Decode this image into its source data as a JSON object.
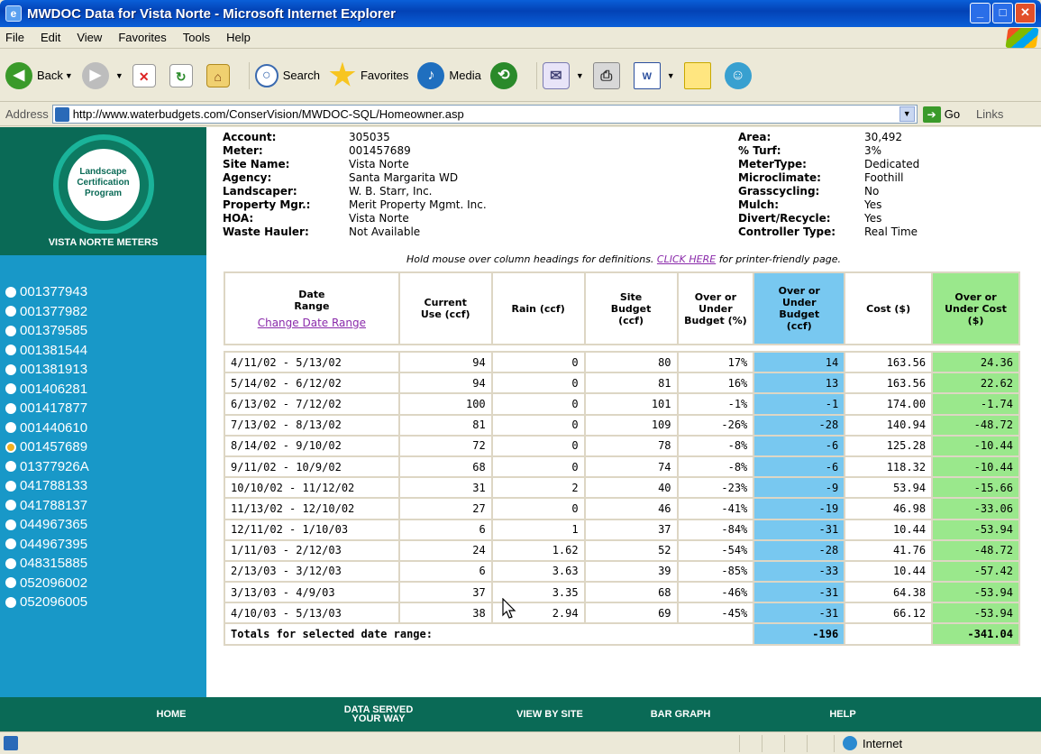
{
  "window": {
    "title": "MWDOC Data for Vista Norte - Microsoft Internet Explorer"
  },
  "menu": [
    "File",
    "Edit",
    "View",
    "Favorites",
    "Tools",
    "Help"
  ],
  "toolbar": {
    "back": "Back",
    "search": "Search",
    "favorites": "Favorites",
    "media": "Media"
  },
  "address": {
    "label": "Address",
    "url": "http://www.waterbudgets.com/ConserVision/MWDOC-SQL/Homeowner.asp",
    "go": "Go",
    "links": "Links"
  },
  "sidebar": {
    "logo_text": "Landscape Certification Program",
    "title": "VISTA NORTE METERS",
    "meters": [
      "001377943",
      "001377982",
      "001379585",
      "001381544",
      "001381913",
      "001406281",
      "001417877",
      "001440610",
      "001457689",
      "01377926A",
      "041788133",
      "041788137",
      "044967365",
      "044967395",
      "048315885",
      "052096002",
      "052096005"
    ],
    "selected_index": 8
  },
  "info_left": [
    {
      "k": "Account:",
      "v": "305035"
    },
    {
      "k": "Meter:",
      "v": "001457689"
    },
    {
      "k": "Site Name:",
      "v": "Vista Norte"
    },
    {
      "k": "Agency:",
      "v": "Santa Margarita WD"
    },
    {
      "k": "Landscaper:",
      "v": "W. B. Starr, Inc."
    },
    {
      "k": "Property Mgr.:",
      "v": "Merit Property Mgmt. Inc."
    },
    {
      "k": "HOA:",
      "v": "Vista Norte"
    },
    {
      "k": "Waste Hauler:",
      "v": "Not Available"
    }
  ],
  "info_right": [
    {
      "k": "Area:",
      "v": "30,492"
    },
    {
      "k": "% Turf:",
      "v": "3%"
    },
    {
      "k": "MeterType:",
      "v": "Dedicated"
    },
    {
      "k": "Microclimate:",
      "v": "Foothill"
    },
    {
      "k": "Grasscycling:",
      "v": "No"
    },
    {
      "k": "Mulch:",
      "v": "Yes"
    },
    {
      "k": "Divert/Recycle:",
      "v": "Yes"
    },
    {
      "k": "Controller Type:",
      "v": "Real Time"
    }
  ],
  "hint": {
    "before": "Hold mouse over column headings for definitions.",
    "link": "CLICK HERE",
    "after": "for printer-friendly page."
  },
  "table": {
    "headers": [
      "Date Range",
      "Current Use (ccf)",
      "Rain (ccf)",
      "Site Budget (ccf)",
      "Over or Under Budget (%)",
      "Over or Under Budget (ccf)",
      "Cost ($)",
      "Over or Under Cost ($)"
    ],
    "change_range": "Change Date Range",
    "rows": [
      [
        "4/11/02 - 5/13/02",
        "94",
        "0",
        "80",
        "17%",
        "14",
        "163.56",
        "24.36"
      ],
      [
        "5/14/02 - 6/12/02",
        "94",
        "0",
        "81",
        "16%",
        "13",
        "163.56",
        "22.62"
      ],
      [
        "6/13/02 - 7/12/02",
        "100",
        "0",
        "101",
        "-1%",
        "-1",
        "174.00",
        "-1.74"
      ],
      [
        "7/13/02 - 8/13/02",
        "81",
        "0",
        "109",
        "-26%",
        "-28",
        "140.94",
        "-48.72"
      ],
      [
        "8/14/02 - 9/10/02",
        "72",
        "0",
        "78",
        "-8%",
        "-6",
        "125.28",
        "-10.44"
      ],
      [
        "9/11/02 - 10/9/02",
        "68",
        "0",
        "74",
        "-8%",
        "-6",
        "118.32",
        "-10.44"
      ],
      [
        "10/10/02 - 11/12/02",
        "31",
        "2",
        "40",
        "-23%",
        "-9",
        "53.94",
        "-15.66"
      ],
      [
        "11/13/02 - 12/10/02",
        "27",
        "0",
        "46",
        "-41%",
        "-19",
        "46.98",
        "-33.06"
      ],
      [
        "12/11/02 - 1/10/03",
        "6",
        "1",
        "37",
        "-84%",
        "-31",
        "10.44",
        "-53.94"
      ],
      [
        "1/11/03 - 2/12/03",
        "24",
        "1.62",
        "52",
        "-54%",
        "-28",
        "41.76",
        "-48.72"
      ],
      [
        "2/13/03 - 3/12/03",
        "6",
        "3.63",
        "39",
        "-85%",
        "-33",
        "10.44",
        "-57.42"
      ],
      [
        "3/13/03 - 4/9/03",
        "37",
        "3.35",
        "68",
        "-46%",
        "-31",
        "64.38",
        "-53.94"
      ],
      [
        "4/10/03 - 5/13/03",
        "38",
        "2.94",
        "69",
        "-45%",
        "-31",
        "66.12",
        "-53.94"
      ]
    ],
    "totals": {
      "label": "Totals for selected date range:",
      "budget_ccf": "-196",
      "cost": "-341.04"
    }
  },
  "footer": {
    "home": "HOME",
    "data_served": "DATA SERVED YOUR WAY",
    "view_by_site": "VIEW BY SITE",
    "bar_graph": "BAR GRAPH",
    "help": "HELP"
  },
  "status": {
    "zone": "Internet"
  }
}
